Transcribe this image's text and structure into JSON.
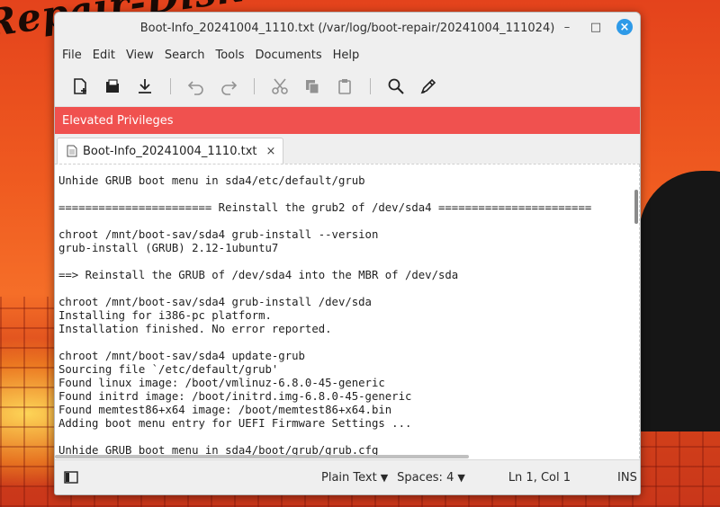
{
  "desktop": {
    "watermark": "Repair-Disk"
  },
  "window": {
    "title": "Boot-Info_20241004_1110.txt (/var/log/boot-repair/20241004_111024)",
    "controls": {
      "minimize": "–",
      "maximize": "□",
      "close": "×"
    }
  },
  "menu": {
    "items": [
      "File",
      "Edit",
      "View",
      "Search",
      "Tools",
      "Documents",
      "Help"
    ]
  },
  "toolbar": {
    "icons": [
      "new-document-icon",
      "open-document-icon",
      "save-download-icon",
      "undo-icon",
      "redo-icon",
      "cut-icon",
      "copy-icon",
      "paste-icon",
      "search-icon",
      "spellcheck-icon"
    ]
  },
  "infobar": {
    "message": "Elevated Privileges"
  },
  "tab": {
    "label": "Boot-Info_20241004_1110.txt",
    "close": "×"
  },
  "editor": {
    "lines": [
      "Unhide GRUB boot menu in sda4/etc/default/grub",
      "",
      "======================= Reinstall the grub2 of /dev/sda4 =======================",
      "",
      "chroot /mnt/boot-sav/sda4 grub-install --version",
      "grub-install (GRUB) 2.12-1ubuntu7",
      "",
      "==> Reinstall the GRUB of /dev/sda4 into the MBR of /dev/sda",
      "",
      "chroot /mnt/boot-sav/sda4 grub-install /dev/sda",
      "Installing for i386-pc platform.",
      "Installation finished. No error reported.",
      "",
      "chroot /mnt/boot-sav/sda4 update-grub",
      "Sourcing file `/etc/default/grub'",
      "Found linux image: /boot/vmlinuz-6.8.0-45-generic",
      "Found initrd image: /boot/initrd.img-6.8.0-45-generic",
      "Found memtest86+x64 image: /boot/memtest86+x64.bin",
      "Adding boot menu entry for UEFI Firmware Settings ...",
      "",
      "Unhide GRUB boot menu in sda4/boot/grub/grub.cfg"
    ]
  },
  "status": {
    "syntax": "Plain Text",
    "spaces": "Spaces: 4",
    "position": "Ln 1, Col 1",
    "mode": "INS"
  },
  "colors": {
    "infobar": "#f0514f",
    "close_button": "#2e9ae8"
  }
}
